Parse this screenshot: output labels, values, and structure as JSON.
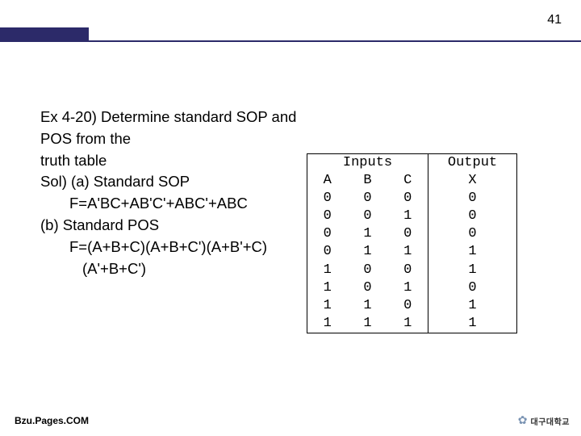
{
  "page_number": "41",
  "body": {
    "line1": "Ex 4-20) Determine standard SOP and POS from the",
    "line2": "truth table",
    "line3": "Sol) (a) Standard SOP",
    "line4": "F=A'BC+AB'C'+ABC'+ABC",
    "line5": "(b) Standard POS",
    "line6": "F=(A+B+C)(A+B+C')(A+B'+C)",
    "line7": "(A'+B+C')"
  },
  "table": {
    "inputs_label": "Inputs",
    "output_label": "Output",
    "col_a": "A",
    "col_b": "B",
    "col_c": "C",
    "col_x": "X",
    "rows": [
      {
        "a": "0",
        "b": "0",
        "c": "0",
        "x": "0"
      },
      {
        "a": "0",
        "b": "0",
        "c": "1",
        "x": "0"
      },
      {
        "a": "0",
        "b": "1",
        "c": "0",
        "x": "0"
      },
      {
        "a": "0",
        "b": "1",
        "c": "1",
        "x": "1"
      },
      {
        "a": "1",
        "b": "0",
        "c": "0",
        "x": "1"
      },
      {
        "a": "1",
        "b": "0",
        "c": "1",
        "x": "0"
      },
      {
        "a": "1",
        "b": "1",
        "c": "0",
        "x": "1"
      },
      {
        "a": "1",
        "b": "1",
        "c": "1",
        "x": "1"
      }
    ]
  },
  "footer": "Bzu.Pages.COM",
  "logo_text": "대구대학교"
}
